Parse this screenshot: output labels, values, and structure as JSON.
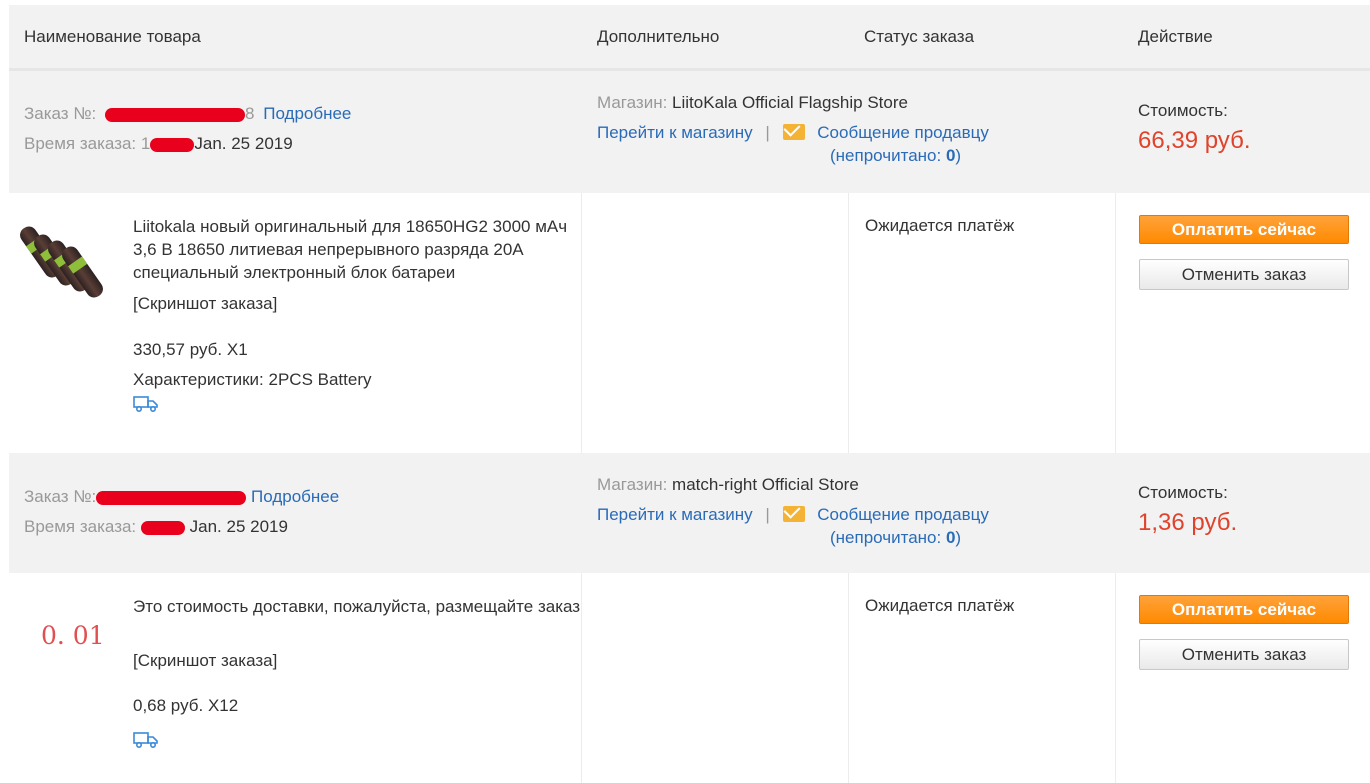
{
  "columns": {
    "product": "Наименование товара",
    "extra": "Дополнительно",
    "status": "Статус заказа",
    "action": "Действие"
  },
  "orders": [
    {
      "order_label": "Заказ №:",
      "order_suffix": "8",
      "details_link": "Подробнее",
      "time_label": "Время заказа:",
      "time_prefix": "1",
      "date": "Jan. 25 2019",
      "store_label": "Магазин:",
      "store_name": "LiitoKala Official Flagship Store",
      "go_store": "Перейти к магазину",
      "divider": "|",
      "message_seller": "Сообщение продавцу",
      "unread_open": "(непрочитано: ",
      "unread_count": "0",
      "unread_close": ")",
      "cost_label": "Стоимость:",
      "cost_value": "66,39 руб.",
      "item_title": "Liitokala новый оригинальный для 18650HG2 3000 мАч 3,6 В 18650 литиевая непрерывного разряда 20A специальный электронный блок батареи",
      "screenshot_link": "[Скриншот заказа]",
      "price_qty": "330,57 руб. X1",
      "specs": "Характеристики: 2PCS Battery",
      "status": "Ожидается платёж",
      "pay_button": "Оплатить сейчас",
      "cancel_button": "Отменить заказ"
    },
    {
      "order_label": "Заказ №:",
      "order_suffix": "",
      "details_link": "Подробнее",
      "time_label": "Время заказа:",
      "time_prefix": "",
      "date": "Jan. 25 2019",
      "store_label": "Магазин:",
      "store_name": "match-right Official Store",
      "go_store": "Перейти к магазину",
      "divider": "|",
      "message_seller": "Сообщение продавцу",
      "unread_open": "(непрочитано: ",
      "unread_count": "0",
      "unread_close": ")",
      "cost_label": "Стоимость:",
      "cost_value": "1,36 руб.",
      "thumb_text": "0. 01",
      "item_title": "Это стоимость доставки, пожалуйста, размещайте заказ",
      "screenshot_link": "[Скриншот заказа]",
      "price_qty": "0,68 руб. X12",
      "status": "Ожидается платёж",
      "pay_button": "Оплатить сейчас",
      "cancel_button": "Отменить заказ"
    }
  ],
  "icons": {
    "mail": "envelope-icon",
    "truck": "delivery-truck-icon"
  },
  "colors": {
    "link": "#2a6bb8",
    "price": "#e0432b",
    "pay_button": "#ff8a00",
    "header_bg": "#f2f2f2"
  }
}
